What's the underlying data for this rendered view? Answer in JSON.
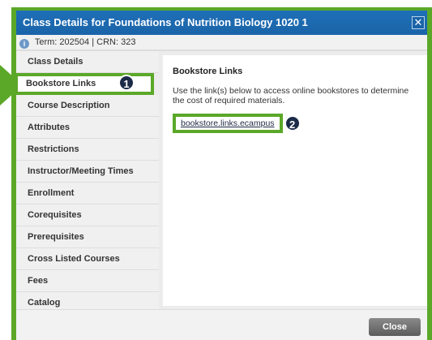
{
  "dialog": {
    "title": "Class Details for Foundations of Nutrition Biology 1020 1",
    "close_x": "✕"
  },
  "term": {
    "label": "Term:",
    "term_value": "202504",
    "separator": "|",
    "crn_label": "CRN:",
    "crn_value": "323"
  },
  "nav": {
    "items": [
      {
        "label": "Class Details"
      },
      {
        "label": "Bookstore Links"
      },
      {
        "label": "Course Description"
      },
      {
        "label": "Attributes"
      },
      {
        "label": "Restrictions"
      },
      {
        "label": "Instructor/Meeting Times"
      },
      {
        "label": "Enrollment"
      },
      {
        "label": "Corequisites"
      },
      {
        "label": "Prerequisites"
      },
      {
        "label": "Cross Listed Courses"
      },
      {
        "label": "Fees"
      },
      {
        "label": "Catalog"
      }
    ],
    "active_index": 1
  },
  "callouts": {
    "one": "1",
    "two": "2"
  },
  "main": {
    "heading": "Bookstore Links",
    "description": "Use the link(s) below to access online bookstores to determine the cost of required materials.",
    "link": "bookstore.links.ecampus"
  },
  "footer": {
    "close_label": "Close"
  },
  "colors": {
    "highlight_green": "#5ba829",
    "title_blue": "#1a64a8",
    "badge_navy": "#1a2a47"
  }
}
